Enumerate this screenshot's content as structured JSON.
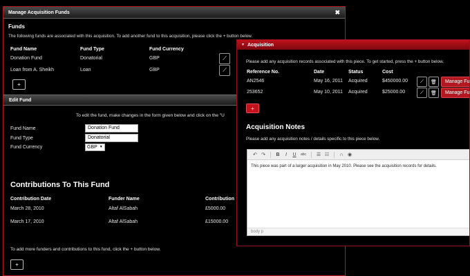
{
  "fund_dialog": {
    "title": "Manage Acquisition Funds",
    "close_icon": "close-icon",
    "funds": {
      "heading": "Funds",
      "description": "The following funds are associated with this acquisition. To add another fund to this acquisition, please click the + button below.",
      "columns": [
        "Fund Name",
        "Fund Type",
        "Fund Currency"
      ],
      "rows": [
        {
          "name": "Donation Fund",
          "type": "Donatorial",
          "currency": "GBP",
          "edit_icon": "edit-icon"
        },
        {
          "name": "Loan from A. Sheikh",
          "type": "Loan",
          "currency": "GBP",
          "edit_icon": "edit-icon"
        }
      ],
      "add_label": "+"
    },
    "edit_fund": {
      "title": "Edit Fund",
      "instruction": "To edit the fund, make changes in the form given below and click on the \"U",
      "fields": {
        "name_label": "Fund Name",
        "name_value": "Donation Fund",
        "type_label": "Fund Type",
        "type_value": "Donatorial",
        "currency_label": "Fund Currency",
        "currency_value": "GBP"
      }
    },
    "contributions": {
      "heading": "Contributions To This Fund",
      "columns": [
        "Contribution Date",
        "Funder Name",
        "Contribution"
      ],
      "rows": [
        {
          "date": "March 28, 2010",
          "funder": "Altaf AlSabah",
          "amount": "£5000.00"
        },
        {
          "date": "March 17, 2010",
          "funder": "Altaf AlSabah",
          "amount": "£15000.00"
        }
      ],
      "footer": "To add more funders and contributions to this fund, click the + button below.",
      "add_label": "+"
    }
  },
  "acq_dialog": {
    "title": "Acquisition",
    "collapse_icon": "caret-down-icon",
    "intro": "Please add any acquisition records associated with this piece. To get started, press the + button below.",
    "columns": [
      "Reference No.",
      "Date",
      "Status",
      "Cost"
    ],
    "rows": [
      {
        "ref": "AN2546",
        "date": "May 16, 2011",
        "status": "Acquired",
        "cost": "$450000.00",
        "manage": "Manage Fun"
      },
      {
        "ref": "253652",
        "date": "May 10, 2011",
        "status": "Acquired",
        "cost": "$25000.00",
        "manage": "Manage Fun"
      }
    ],
    "add_label": "+",
    "notes": {
      "heading": "Acquisition Notes",
      "description": "Please add any acquisition notes / details specific to this piece below.",
      "body": "This piece was part of a larger acquisition in May 2010. Please see the acquisition records for details.",
      "status_path": "body  p",
      "toolbar": {
        "bold": "B",
        "italic": "I",
        "underline": "U",
        "strike": "abc"
      }
    }
  }
}
